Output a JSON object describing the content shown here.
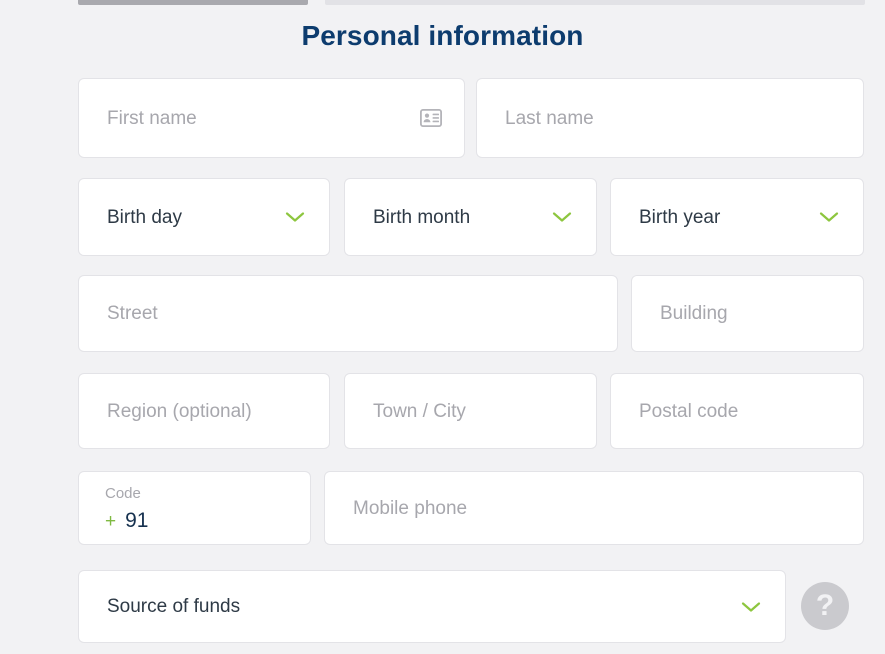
{
  "steps": {
    "active_label": "step-active",
    "inactive_label": "step-inactive"
  },
  "header": {
    "title": "Personal information",
    "title_color": "#0d3c6e"
  },
  "theme": {
    "background": "#f2f2f4",
    "field_background": "#ffffff",
    "field_border": "#e3e3e7",
    "placeholder_color": "#a7a7ad",
    "accent_green": "#7fba42",
    "navy": "#16314f",
    "help_circle": "#cacace"
  },
  "form": {
    "first_name": {
      "placeholder": "First name",
      "value": "",
      "icon": "id-card-icon"
    },
    "last_name": {
      "placeholder": "Last name",
      "value": ""
    },
    "birth_day": {
      "label": "Birth day",
      "selected": "Birth day",
      "icon": "chevron-down-icon"
    },
    "birth_month": {
      "label": "Birth month",
      "selected": "Birth month",
      "icon": "chevron-down-icon"
    },
    "birth_year": {
      "label": "Birth year",
      "selected": "Birth year",
      "icon": "chevron-down-icon"
    },
    "street": {
      "placeholder": "Street",
      "value": ""
    },
    "building": {
      "placeholder": "Building",
      "value": ""
    },
    "region": {
      "placeholder": "Region (optional)",
      "value": ""
    },
    "town_city": {
      "placeholder": "Town / City",
      "value": ""
    },
    "postal_code": {
      "placeholder": "Postal code",
      "value": ""
    },
    "phone_code": {
      "label": "Code",
      "plus": "+",
      "value": "91"
    },
    "mobile_phone": {
      "placeholder": "Mobile phone",
      "value": ""
    },
    "source_of_funds": {
      "label": "Source of funds",
      "selected": "Source of funds",
      "icon": "chevron-down-icon"
    }
  },
  "help": {
    "glyph": "?",
    "icon": "question-mark-icon"
  }
}
